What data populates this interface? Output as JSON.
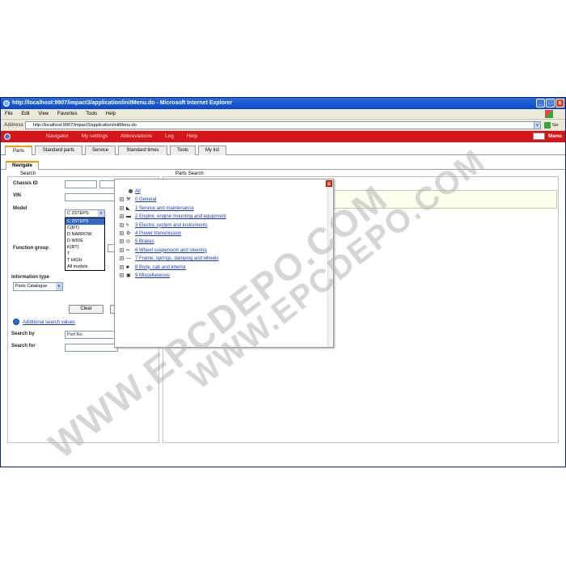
{
  "window": {
    "title": "http://localhost:9907/impact3/application/initMenu.do - Microsoft Internet Explorer",
    "minimize": "_",
    "maximize": "□",
    "close": "x"
  },
  "menubar": {
    "items": [
      "File",
      "Edit",
      "View",
      "Favorites",
      "Tools",
      "Help"
    ]
  },
  "addressbar": {
    "label": "Address",
    "url": "http://localhost:9907/impact3/application/initMenu.do",
    "go": "Go",
    "dropdown": "v"
  },
  "appbar": {
    "nav": [
      "Navigator",
      "My settings",
      "Abbreviations",
      "Log",
      "Help"
    ],
    "menu": "Menu"
  },
  "tabs": [
    "Parts",
    "Standard parts",
    "Service",
    "Standard times",
    "Tools",
    "My list"
  ],
  "subtab": "Navigate",
  "search": {
    "legend": "Search",
    "chassis_label": "Chassis ID",
    "vin_label": "VIN",
    "model_label": "Model",
    "model_selected": "C 2STEPS",
    "model_options": [
      "C 2STEPS",
      "C(RT)",
      "D NARROW",
      "D WIDE",
      "K(RT)",
      "T",
      "T HIGH",
      "All models"
    ],
    "function_group_label": "Function group",
    "information_type_label": "Information type",
    "information_type_value": "Parts Catalogue",
    "clear_button": "Clear",
    "additional_link": "Additional search values",
    "search_by_label": "Search by",
    "search_by_value": "Part No.",
    "search_for_label": "Search for",
    "dropdown_arrow": "v"
  },
  "parts_search": {
    "legend": "Parts Search"
  },
  "popup": {
    "close": "x",
    "tree": [
      {
        "label": "All",
        "icon": "dot-icon",
        "toggle": ""
      },
      {
        "label": "0 General",
        "icon": "wrench-icon",
        "toggle": "+"
      },
      {
        "label": "1 Service and maintenance",
        "icon": "service-icon",
        "toggle": "+"
      },
      {
        "label": "2 Engine, engine mounting and equipment",
        "icon": "engine-icon",
        "toggle": "+"
      },
      {
        "label": "3 Electric system and instruments",
        "icon": "electric-icon",
        "toggle": "+"
      },
      {
        "label": "4 Power transmission",
        "icon": "gear-icon",
        "toggle": "+"
      },
      {
        "label": "5 Brakes",
        "icon": "brake-icon",
        "toggle": "+"
      },
      {
        "label": "6 Wheel suspension and steering",
        "icon": "wheel-icon",
        "toggle": "+"
      },
      {
        "label": "7 Frame, springs, damping and wheels",
        "icon": "frame-icon",
        "toggle": "+"
      },
      {
        "label": "8 Body, cab and interior",
        "icon": "cab-icon",
        "toggle": "+"
      },
      {
        "label": "9 Miscellaneous",
        "icon": "misc-icon",
        "toggle": "+"
      }
    ]
  },
  "watermark": {
    "line1": "WWW.EPCDEPO.COM",
    "line2": "WWW.EPCDEPO.COM"
  }
}
